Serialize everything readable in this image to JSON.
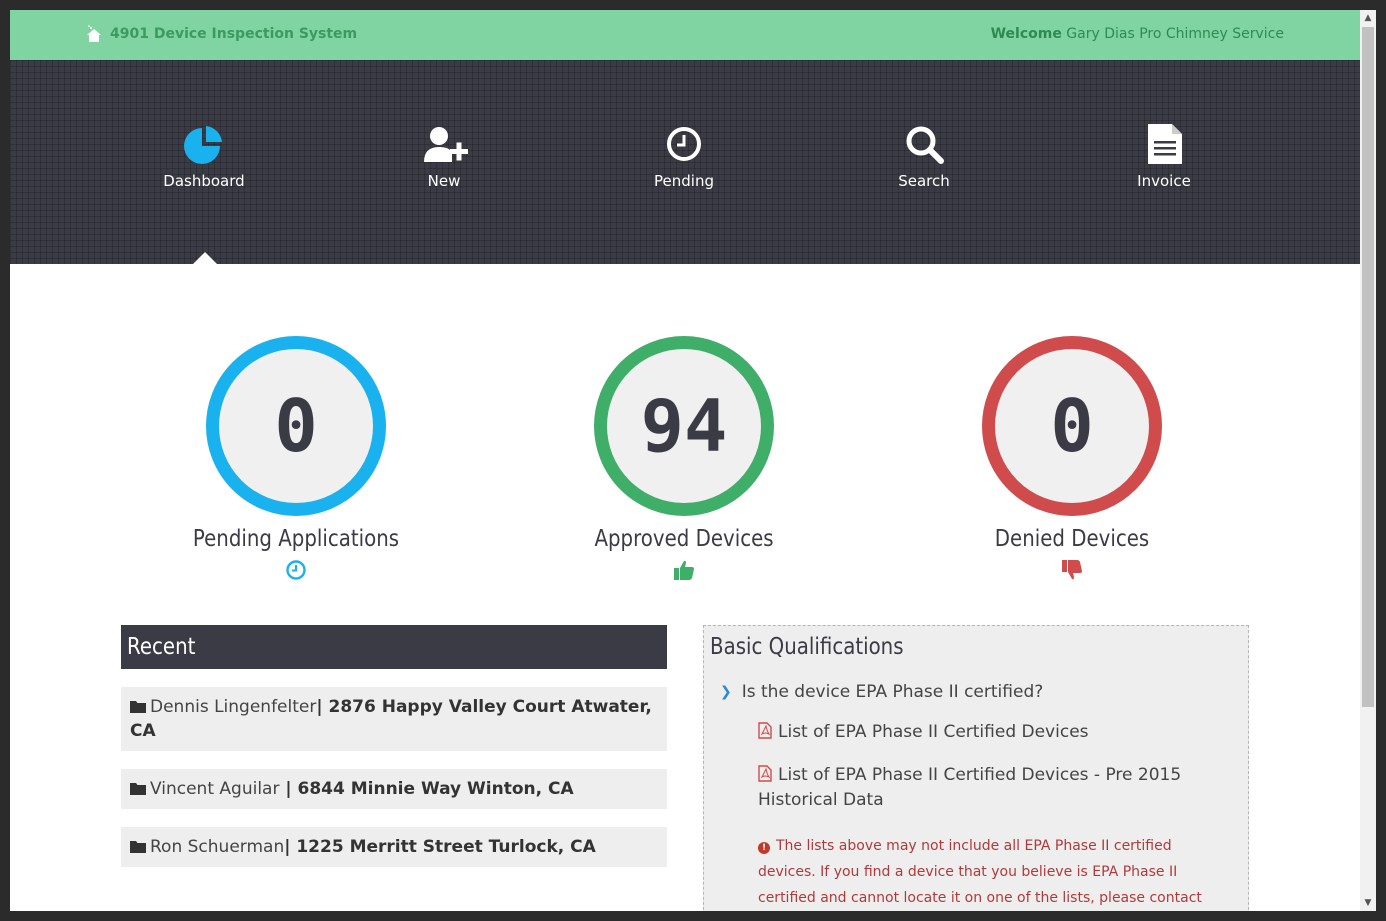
{
  "header": {
    "title": "4901 Device Inspection System",
    "welcome_label": "Welcome",
    "welcome_name": "Gary Dias Pro Chimney Service"
  },
  "nav": {
    "items": [
      {
        "label": "Dashboard",
        "icon": "pie-chart-icon"
      },
      {
        "label": "New",
        "icon": "user-plus-icon"
      },
      {
        "label": "Pending",
        "icon": "clock-icon"
      },
      {
        "label": "Search",
        "icon": "search-icon"
      },
      {
        "label": "Invoice",
        "icon": "document-icon"
      }
    ],
    "active": "Dashboard"
  },
  "stats": [
    {
      "value": "0",
      "label": "Pending Applications",
      "color": "#1ab1ef",
      "icon": "clock-icon"
    },
    {
      "value": "94",
      "label": "Approved Devices",
      "color": "#3fae69",
      "icon": "thumbs-up-icon"
    },
    {
      "value": "0",
      "label": "Denied Devices",
      "color": "#d04b4b",
      "icon": "thumbs-down-icon"
    }
  ],
  "recent": {
    "title": "Recent",
    "items": [
      {
        "name": "Dennis Lingenfelter",
        "address": "| 2876 Happy Valley Court Atwater, CA"
      },
      {
        "name": "Vincent Aguilar",
        "address": " | 6844 Minnie Way Winton, CA"
      },
      {
        "name": "Ron Schuerman",
        "address": "| 1225 Merritt Street Turlock, CA"
      }
    ]
  },
  "qualifications": {
    "title": "Basic Qualifications",
    "question": "Is the device EPA Phase II certified?",
    "links": [
      "List of EPA Phase II Certified Devices",
      "List of EPA Phase II Certified Devices - Pre 2015 Historical Data"
    ],
    "notice": "The lists above may not include all EPA Phase II certified devices. If you find a device that you believe is EPA Phase II certified and cannot locate it on one of the lists, please contact the District for assistance."
  },
  "colors": {
    "topbar": "#80d4a2",
    "nav_bg": "#3a3b45",
    "dashboard_icon": "#1ab1ef"
  }
}
